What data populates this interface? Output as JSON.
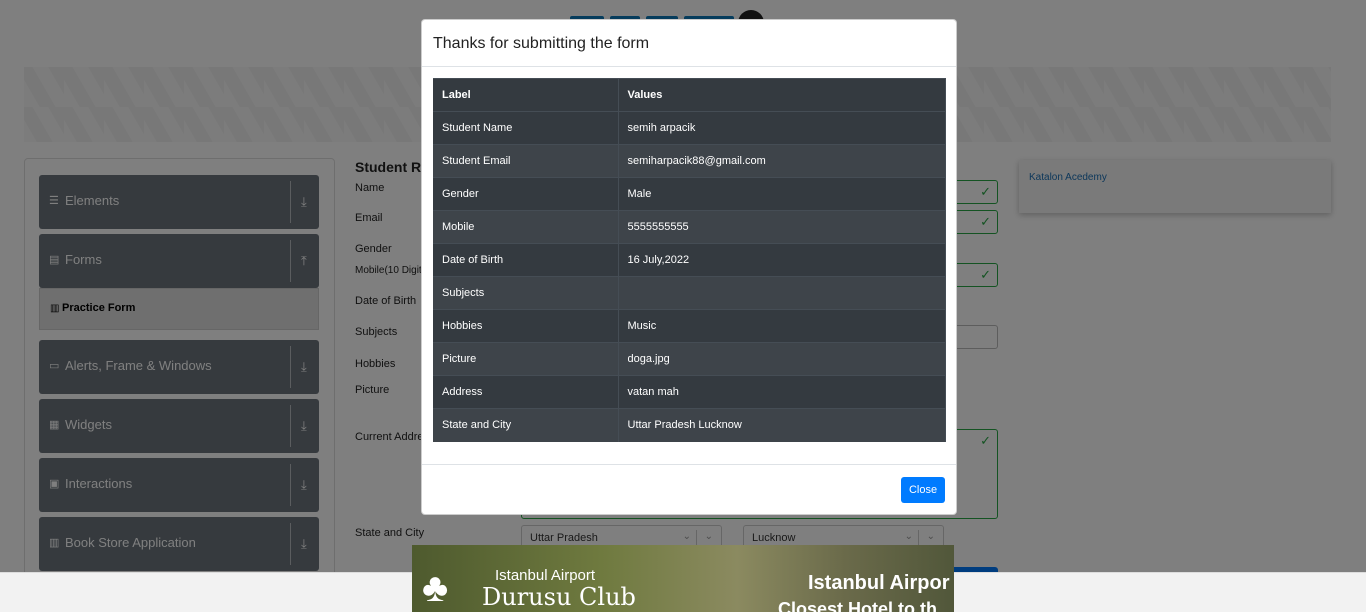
{
  "sidebar": {
    "groups": [
      {
        "label": "Elements",
        "icon": "hamburger-icon",
        "arrow": "download-icon"
      },
      {
        "label": "Forms",
        "icon": "form-icon",
        "arrow": "upload-icon"
      },
      {
        "label": "Alerts, Frame & Windows",
        "icon": "window-icon",
        "arrow": "download-icon"
      },
      {
        "label": "Widgets",
        "icon": "widgets-icon",
        "arrow": "download-icon"
      },
      {
        "label": "Interactions",
        "icon": "interactions-icon",
        "arrow": "download-icon"
      },
      {
        "label": "Book Store Application",
        "icon": "book-icon",
        "arrow": "download-icon"
      }
    ],
    "active_item": "Practice Form"
  },
  "form": {
    "title": "Student Re",
    "labels": {
      "name": "Name",
      "email": "Email",
      "gender": "Gender",
      "mobile": "Mobile(10 Digit",
      "dob": "Date of Birth",
      "subjects": "Subjects",
      "hobbies": "Hobbies",
      "picture": "Picture",
      "address": "Current Addre",
      "state_city": "State and City"
    },
    "state_value": "Uttar Pradesh",
    "city_value": "Lucknow"
  },
  "side_ad": {
    "alt_text": "Katalon Acedemy"
  },
  "modal": {
    "title": "Thanks for submitting the form",
    "header": {
      "label": "Label",
      "value": "Values"
    },
    "rows": [
      {
        "label": "Student Name",
        "value": "semih arpacik"
      },
      {
        "label": "Student Email",
        "value": "semiharpacik88@gmail.com"
      },
      {
        "label": "Gender",
        "value": "Male"
      },
      {
        "label": "Mobile",
        "value": "5555555555"
      },
      {
        "label": "Date of Birth",
        "value": "16 July,2022"
      },
      {
        "label": "Subjects",
        "value": ""
      },
      {
        "label": "Hobbies",
        "value": "Music"
      },
      {
        "label": "Picture",
        "value": "doga.jpg"
      },
      {
        "label": "Address",
        "value": "vatan mah"
      },
      {
        "label": "State and City",
        "value": "Uttar Pradesh Lucknow"
      }
    ],
    "close_label": "Close"
  },
  "bottom_ad": {
    "line1": "Istanbul Airport",
    "line2": "Durusu Club",
    "line3": "Istanbul Airpor",
    "line4": "Closest Hotel to th"
  },
  "colors": {
    "primary": "#007bff",
    "success": "#28a745",
    "table_dark": "#343a40",
    "sidebar_group": "#6c757d"
  }
}
